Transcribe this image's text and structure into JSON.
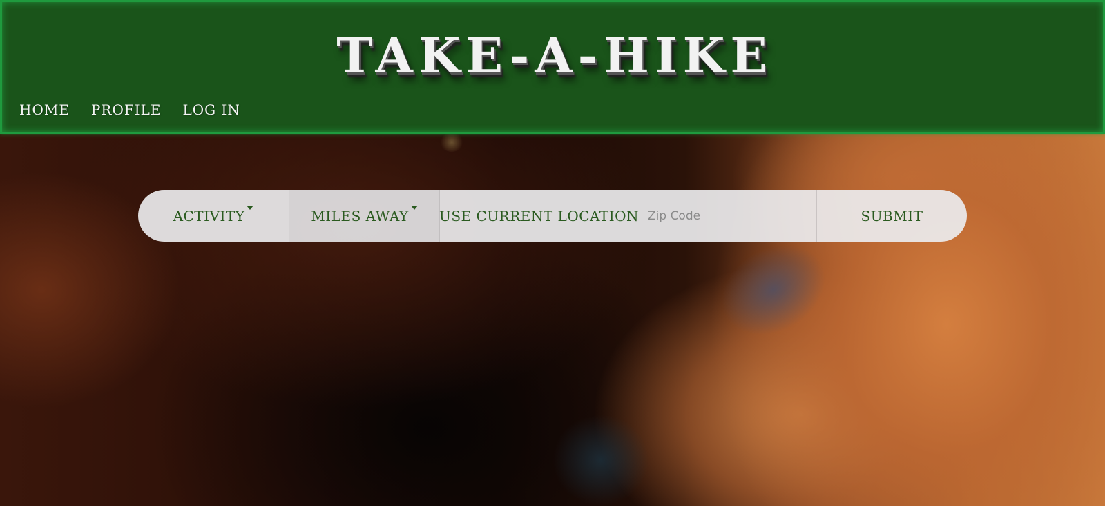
{
  "header": {
    "title": "TAKE-A-HIKE",
    "nav": [
      {
        "label": "HOME"
      },
      {
        "label": "PROFILE"
      },
      {
        "label": "LOG IN"
      }
    ]
  },
  "search": {
    "activity_label": "ACTIVITY",
    "miles_label": "MILES AWAY",
    "location_label": "USE CURRENT LOCATION",
    "zip_placeholder": "Zip Code",
    "zip_value": "",
    "submit_label": "SUBMIT"
  },
  "colors": {
    "header_bg": "#1a541a",
    "header_border": "#1f9a3e",
    "accent_text": "#2a5a1f",
    "search_bg": "#ececee"
  },
  "background": {
    "description_icon": "canyon-landscape-image"
  }
}
